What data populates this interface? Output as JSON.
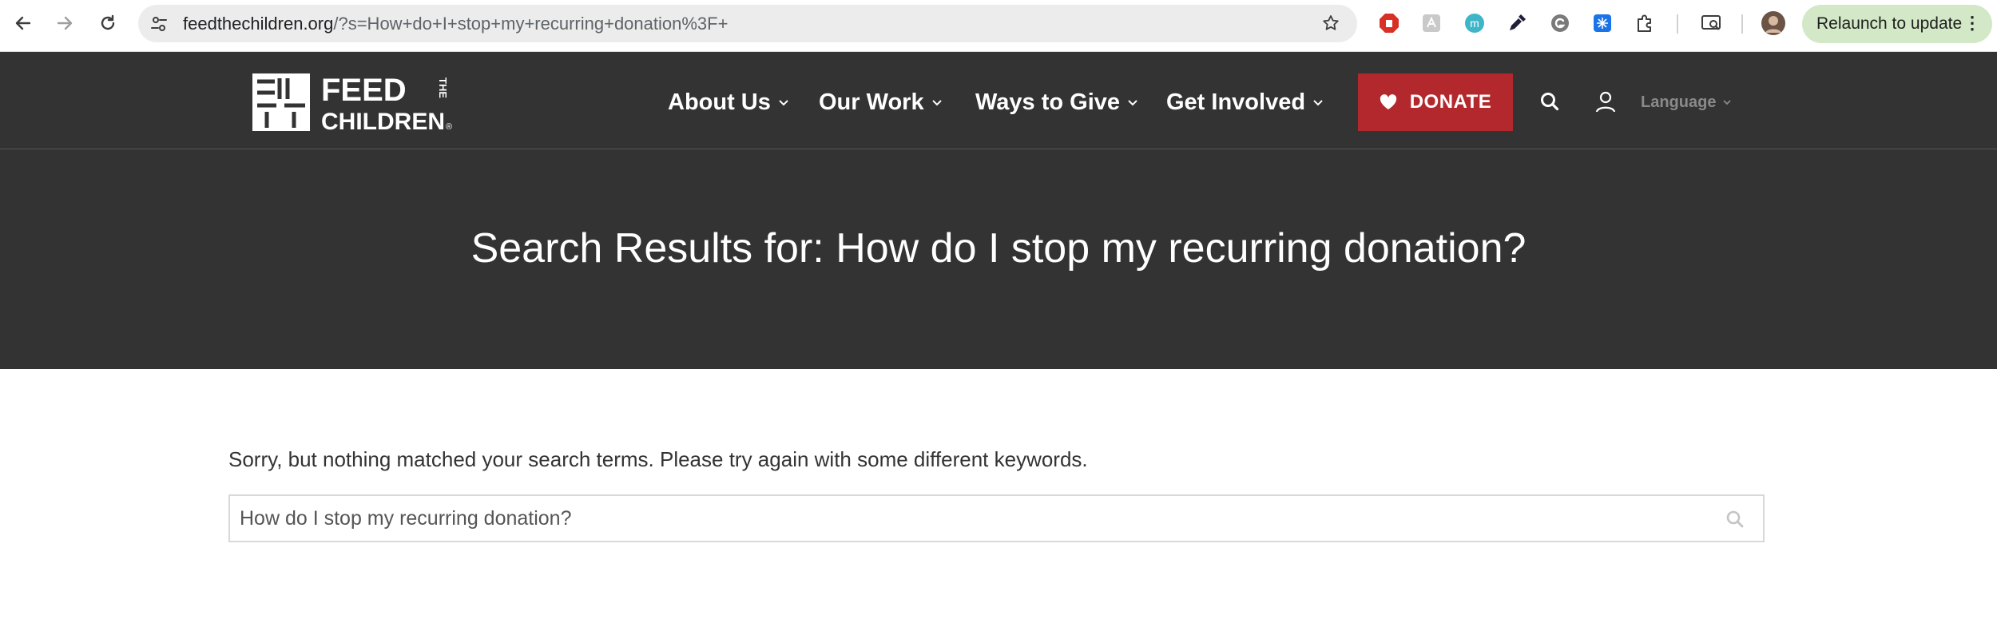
{
  "browser": {
    "url_host": "feedthechildren.org",
    "url_path": "/?s=How+do+I+stop+my+recurring+donation%3F+",
    "relaunch_label": "Relaunch to update",
    "relaunch_menu": "⋮",
    "extension_m_label": "m"
  },
  "site": {
    "logo_line1": "FEED",
    "logo_line2": "CHILDREN",
    "logo_the": "THE",
    "logo_reg": "®",
    "nav": {
      "about": "About Us",
      "work": "Our Work",
      "give": "Ways to Give",
      "involved": "Get Involved"
    },
    "donate_label": "DONATE",
    "language_label": "Language"
  },
  "hero": {
    "title": "Search Results for: How do I stop my recurring donation?"
  },
  "results": {
    "message": "Sorry, but nothing matched your search terms. Please try again with some different keywords.",
    "search_value": "How do I stop my recurring donation?"
  },
  "colors": {
    "header_bg": "#333333",
    "donate_bg": "#b3282d",
    "relaunch_bg": "#d3e8c6"
  }
}
